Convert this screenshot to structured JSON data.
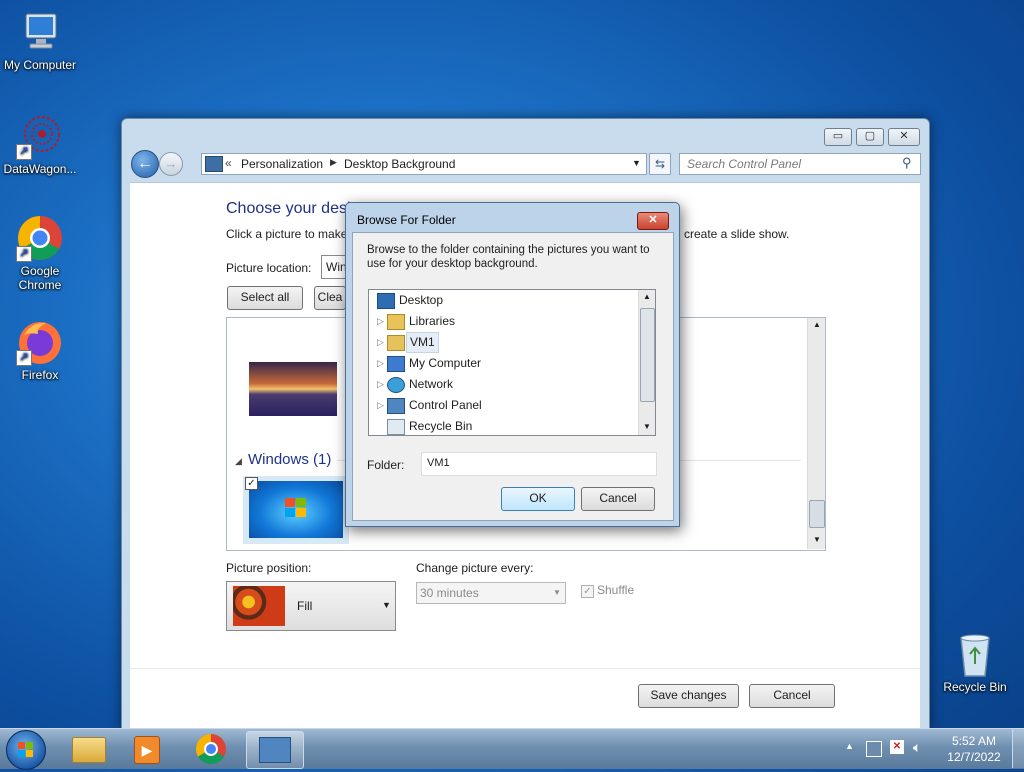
{
  "desktop": {
    "icons": [
      {
        "label": "My Computer"
      },
      {
        "label": "DataWagon..."
      },
      {
        "label": "Google Chrome"
      },
      {
        "label": "Firefox"
      },
      {
        "label": "Recycle Bin"
      }
    ]
  },
  "window": {
    "breadcrumb": {
      "sep": "«",
      "items": [
        "Personalization",
        "Desktop Background"
      ]
    },
    "search_placeholder": "Search Control Panel",
    "heading": "Choose your desk",
    "instruction_left": "Click a picture to make",
    "instruction_right": "create a slide show.",
    "picture_location_label": "Picture location:",
    "picture_location_value": "Win",
    "select_all_label": "Select all",
    "clear_all_label": "Clea",
    "group_label": "Windows (1)",
    "picture_position_label": "Picture position:",
    "picture_position_value": "Fill",
    "change_every_label": "Change picture every:",
    "change_every_value": "30 minutes",
    "shuffle_label": "Shuffle",
    "save_label": "Save changes",
    "cancel_label": "Cancel"
  },
  "dialog": {
    "title": "Browse For Folder",
    "description": "Browse to the folder containing the pictures you want to use for your desktop background.",
    "tree": [
      {
        "label": "Desktop",
        "icon": "desktop-icon"
      },
      {
        "label": "Libraries",
        "icon": "libraries-icon"
      },
      {
        "label": "VM1",
        "icon": "user-folder-icon",
        "selected": true
      },
      {
        "label": "My Computer",
        "icon": "computer-icon"
      },
      {
        "label": "Network",
        "icon": "network-icon"
      },
      {
        "label": "Control Panel",
        "icon": "control-panel-icon"
      },
      {
        "label": "Recycle Bin",
        "icon": "recycle-bin-icon"
      }
    ],
    "folder_label": "Folder:",
    "folder_value": "VM1",
    "ok_label": "OK",
    "cancel_label": "Cancel"
  },
  "taskbar": {
    "time": "5:52 AM",
    "date": "12/7/2022"
  }
}
